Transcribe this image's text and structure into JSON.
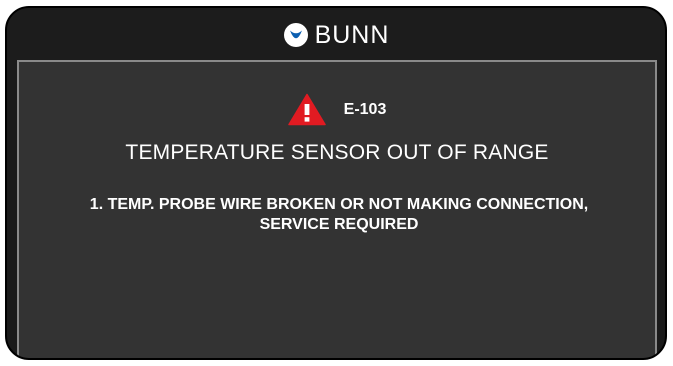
{
  "header": {
    "brand_name": "BUNN"
  },
  "error": {
    "icon": "warning-triangle-icon",
    "code": "E-103",
    "title": "TEMPERATURE SENSOR OUT OF RANGE",
    "detail_line_1": "1. TEMP. PROBE WIRE BROKEN OR NOT MAKING CONNECTION,",
    "detail_line_2": "SERVICE REQUIRED"
  },
  "colors": {
    "frame": "#1a1a1a",
    "panel": "#333333",
    "panel_border": "#8a8a8a",
    "text": "#ffffff",
    "warning_red": "#e11b22",
    "brand_blue": "#0b5fb1"
  }
}
